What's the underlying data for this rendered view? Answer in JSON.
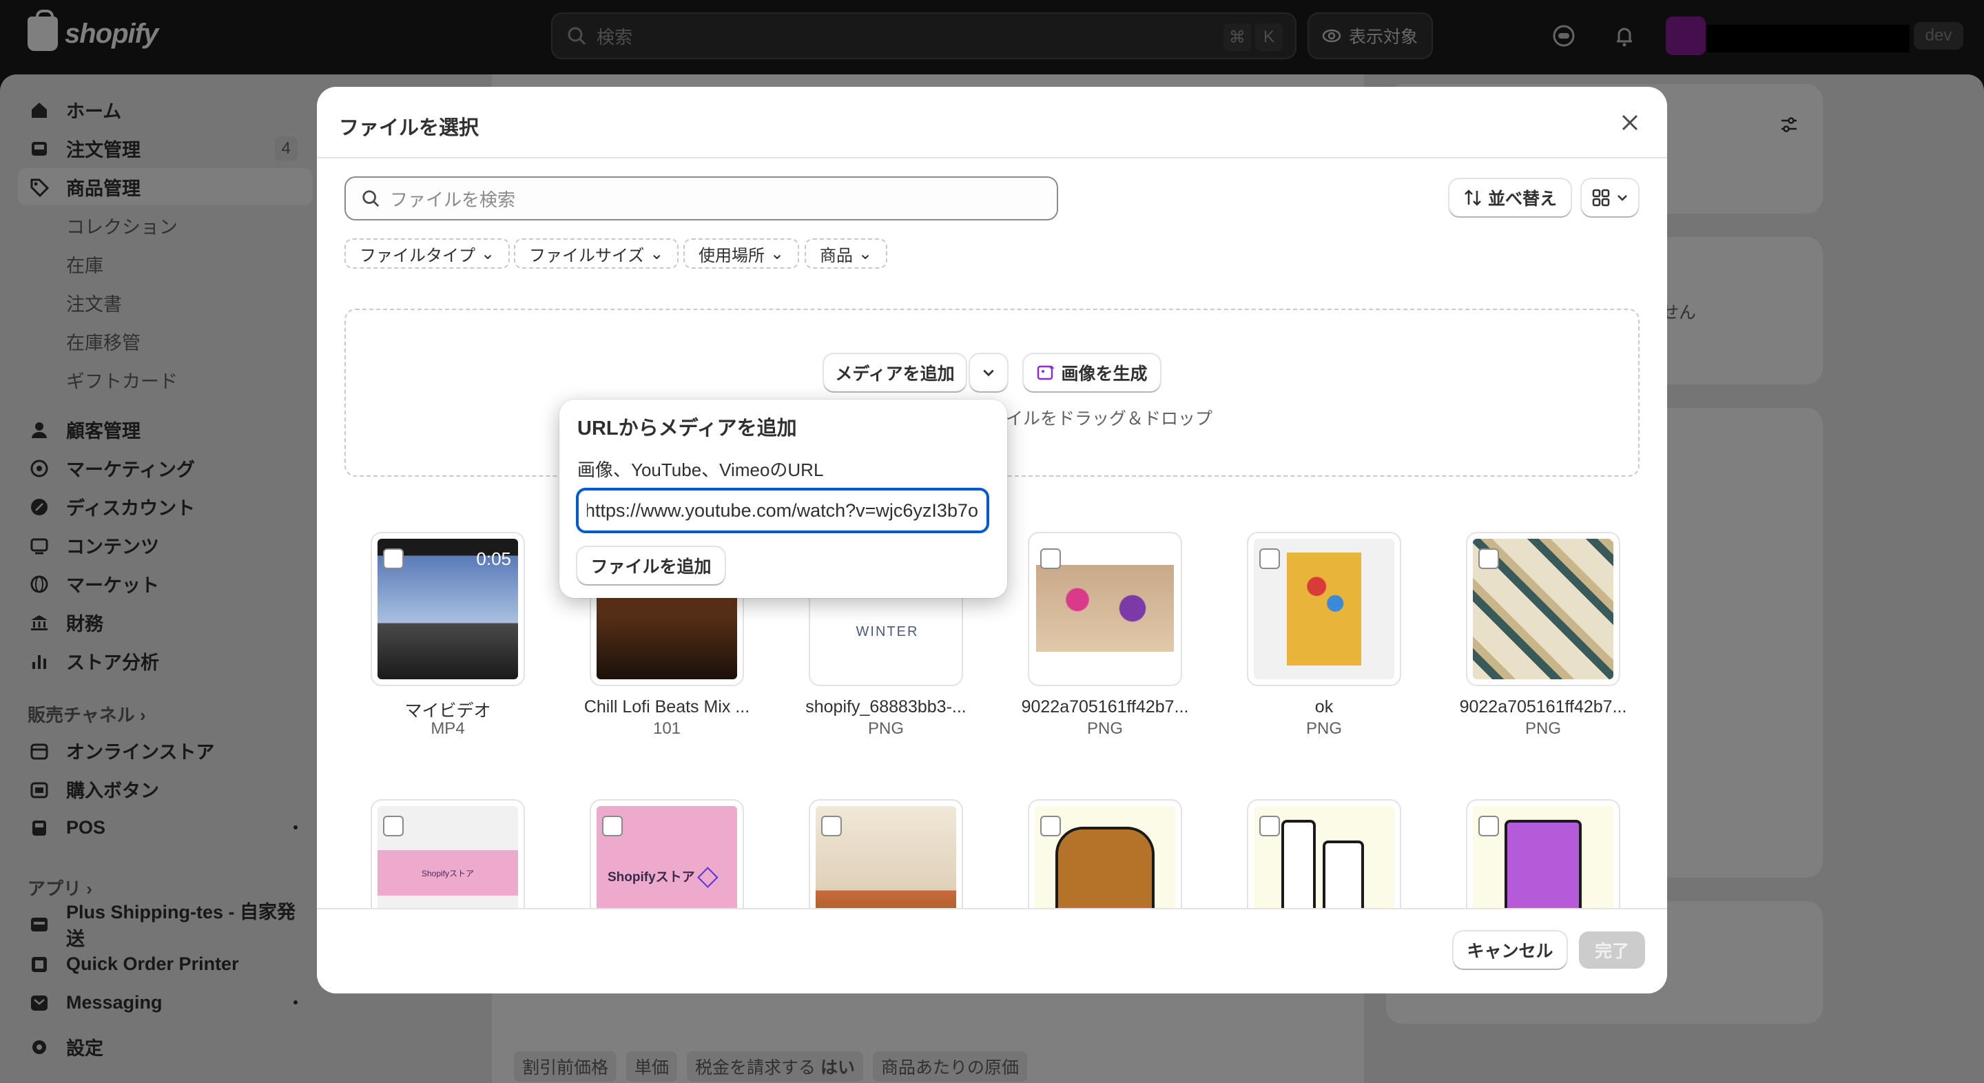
{
  "topbar": {
    "brand": "shopify",
    "search_placeholder": "検索",
    "shortcut_cmd": "⌘",
    "shortcut_key": "K",
    "preview_label": "表示対象",
    "dev_badge": "dev"
  },
  "sidebar": {
    "items": [
      {
        "label": "ホーム",
        "icon": "home-icon"
      },
      {
        "label": "注文管理",
        "icon": "inbox-icon",
        "count": "4"
      },
      {
        "label": "商品管理",
        "icon": "tag-icon"
      },
      {
        "label": "コレクション"
      },
      {
        "label": "在庫"
      },
      {
        "label": "注文書"
      },
      {
        "label": "在庫移管"
      },
      {
        "label": "ギフトカード"
      },
      {
        "label": "顧客管理",
        "icon": "person-icon"
      },
      {
        "label": "マーケティング",
        "icon": "target-icon"
      },
      {
        "label": "ディスカウント",
        "icon": "discount-icon"
      },
      {
        "label": "コンテンツ",
        "icon": "content-icon"
      },
      {
        "label": "マーケット",
        "icon": "globe-icon"
      },
      {
        "label": "財務",
        "icon": "bank-icon"
      },
      {
        "label": "ストア分析",
        "icon": "chart-icon"
      }
    ],
    "channels_heading": "販売チャネル",
    "channels": [
      {
        "label": "オンラインストア",
        "icon": "store-icon"
      },
      {
        "label": "購入ボタン",
        "icon": "button-icon"
      },
      {
        "label": "POS",
        "icon": "pos-icon"
      }
    ],
    "apps_heading": "アプリ",
    "apps": [
      {
        "label": "Plus Shipping-tes - 自家発送",
        "icon": "app-icon"
      },
      {
        "label": "Quick Order Printer",
        "icon": "app-icon"
      },
      {
        "label": "Messaging",
        "icon": "app-icon"
      }
    ],
    "settings": "設定"
  },
  "background": {
    "right_text": "せん",
    "bottom_chips": [
      "割引前価格",
      "単価",
      "税金を請求する",
      "はい",
      "商品あたりの原価"
    ]
  },
  "modal": {
    "title": "ファイルを選択",
    "search_placeholder": "ファイルを検索",
    "sort_label": "並べ替え",
    "filters": [
      "ファイルタイプ",
      "ファイルサイズ",
      "使用場所",
      "商品"
    ],
    "add_media": "メディアを追加",
    "generate_image": "画像を生成",
    "drop_hint": "イルをドラッグ＆ドロップ",
    "files": [
      {
        "name": "マイビデオ",
        "type": "MP4",
        "duration": "0:05"
      },
      {
        "name": "Chill Lofi Beats Mix ...",
        "type": "101"
      },
      {
        "name": "shopify_68883bb3-...",
        "type": "PNG",
        "thumb_text": "WINTER"
      },
      {
        "name": "9022a705161ff42b7...",
        "type": "PNG"
      },
      {
        "name": "ok",
        "type": "PNG"
      },
      {
        "name": "9022a705161ff42b7...",
        "type": "PNG"
      }
    ],
    "row2_thumb_texts": [
      "Shopifyストア",
      "Shopifyストア"
    ],
    "cancel": "キャンセル",
    "done": "完了"
  },
  "popover": {
    "title": "URLからメディアを追加",
    "label": "画像、YouTube、VimeoのURL",
    "url_value": "https://www.youtube.com/watch?v=wjc6yzI3b7o",
    "add_file": "ファイルを追加"
  }
}
